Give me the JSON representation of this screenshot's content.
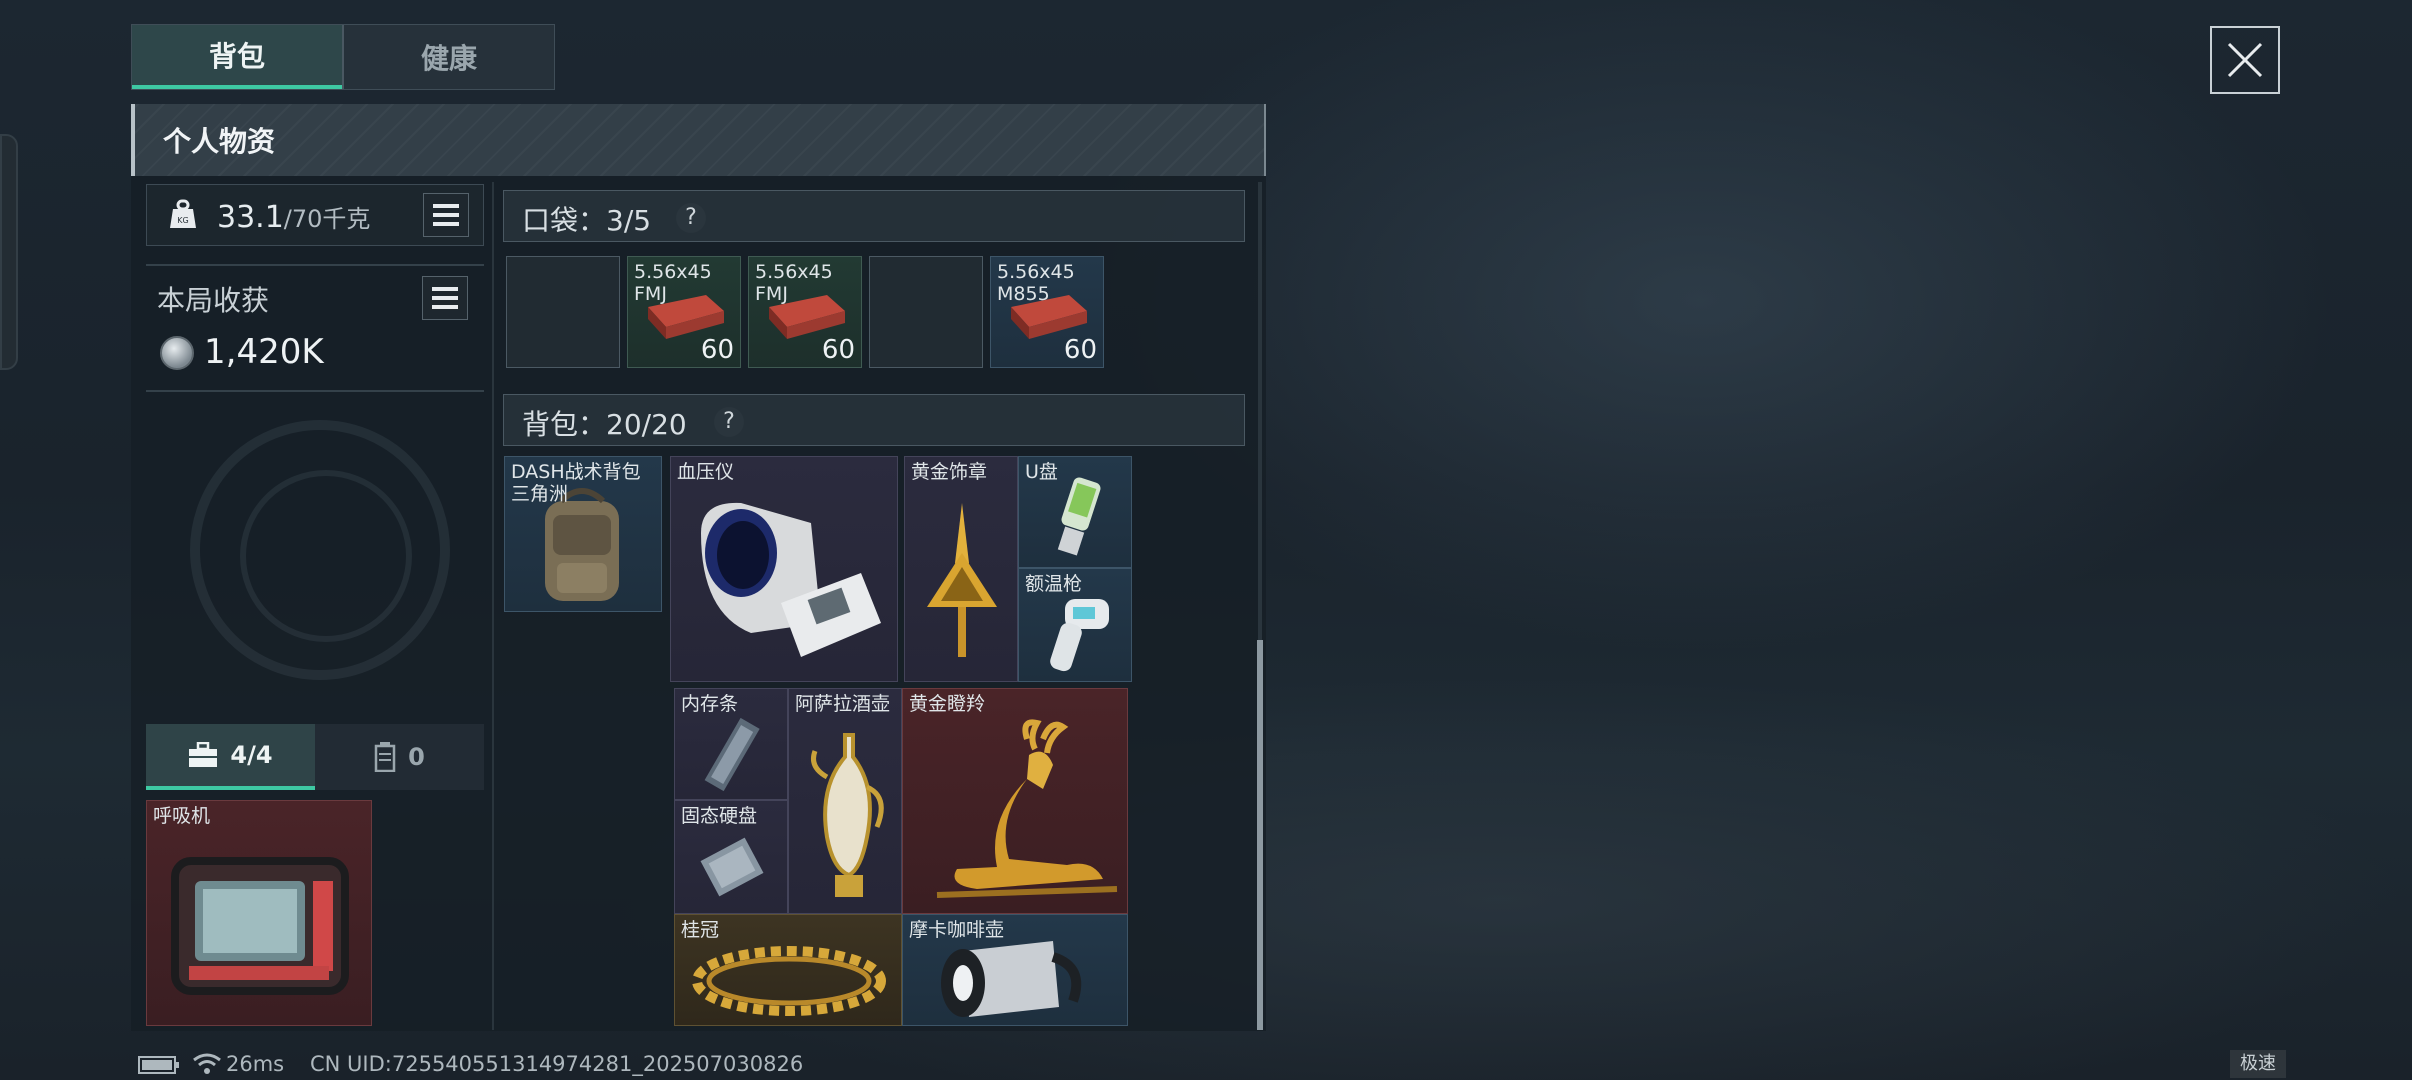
{
  "tabs": [
    {
      "label": "背包"
    },
    {
      "label": "健康"
    }
  ],
  "panel": {
    "title": "个人物资"
  },
  "weight": {
    "current": "33.1",
    "max": "/70千克"
  },
  "harvest": {
    "label": "本局收获",
    "value": "1,420K"
  },
  "sub_tabs": [
    {
      "label": "4/4",
      "icon": "toolbox-icon"
    },
    {
      "label": "0",
      "icon": "container-icon"
    }
  ],
  "secure_item": {
    "name": "呼吸机",
    "rarity": "red"
  },
  "pocket": {
    "label": "口袋：3/5",
    "help": "?",
    "slots": [
      {
        "name": "",
        "count": "",
        "rarity": "empty"
      },
      {
        "name": "5.56x45 FMJ",
        "count": "60",
        "rarity": "green"
      },
      {
        "name": "5.56x45 FMJ",
        "count": "60",
        "rarity": "green"
      },
      {
        "name": "",
        "count": "",
        "rarity": "empty"
      },
      {
        "name": "5.56x45 M855",
        "count": "60",
        "rarity": "blue"
      }
    ]
  },
  "backpack": {
    "label": "背包：20/20",
    "help": "?",
    "items": [
      {
        "name": "DASH战术背包 三角洲",
        "rarity": "blue"
      },
      {
        "name": "血压仪",
        "rarity": "purple"
      },
      {
        "name": "黄金饰章",
        "rarity": "purple"
      },
      {
        "name": "U盘",
        "rarity": "blue"
      },
      {
        "name": "额温枪",
        "rarity": "blue"
      },
      {
        "name": "内存条",
        "rarity": "purple"
      },
      {
        "name": "阿萨拉酒壶",
        "rarity": "purple"
      },
      {
        "name": "黄金瞪羚",
        "rarity": "red"
      },
      {
        "name": "固态硬盘",
        "rarity": "purple"
      },
      {
        "name": "桂冠",
        "rarity": "gold"
      },
      {
        "name": "摩卡咖啡壶",
        "rarity": "blue"
      }
    ]
  },
  "status": {
    "ping": "26ms",
    "uid": "CN UID:725540551314974281_202507030826",
    "speed": "极速"
  }
}
